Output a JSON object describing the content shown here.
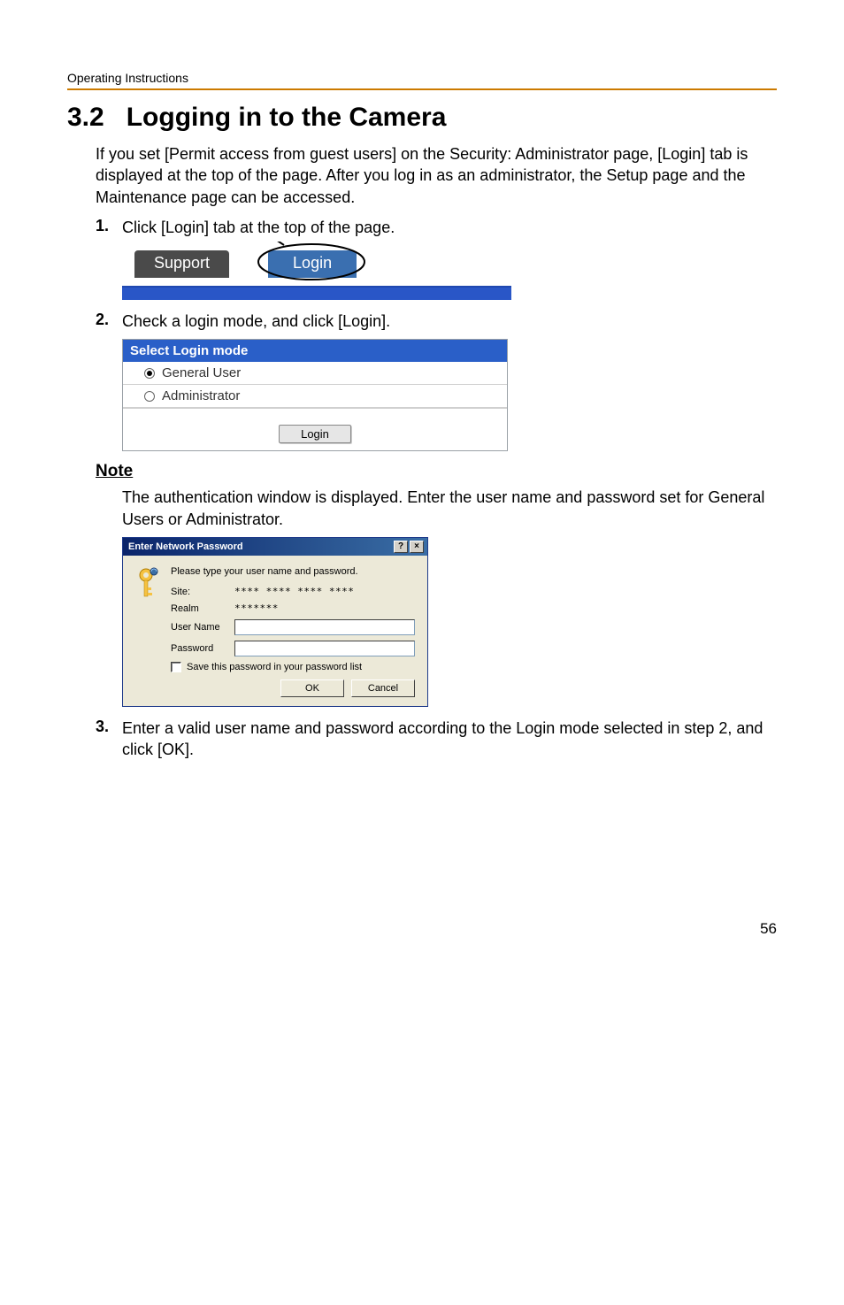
{
  "header": {
    "running": "Operating Instructions"
  },
  "section": {
    "number": "3.2",
    "title": "Logging in to the Camera",
    "intro": "If you set [Permit access from guest users] on the Security: Administrator page, [Login] tab is displayed at the top of the page. After you log in as an administrator, the Setup page and the Maintenance page can be accessed."
  },
  "steps": {
    "s1": {
      "num": "1.",
      "text": "Click [Login] tab at the top of the page."
    },
    "s2": {
      "num": "2.",
      "text": "Check a login mode, and click [Login]."
    },
    "s3": {
      "num": "3.",
      "text": "Enter a valid user name and password according to the Login mode selected in step 2, and click [OK]."
    }
  },
  "fig_tabs": {
    "support": "Support",
    "login": "Login"
  },
  "fig_login_mode": {
    "title": "Select Login mode",
    "opt_general": "General User",
    "opt_admin": "Administrator",
    "login_btn": "Login"
  },
  "note": {
    "heading": "Note",
    "body": "The authentication window is displayed. Enter the user name and password set for General Users or Administrator."
  },
  "fig_pw": {
    "title": "Enter Network Password",
    "help_btn": "?",
    "close_btn": "×",
    "instruction": "Please type your user name and password.",
    "site_label": "Site:",
    "site_value": "**** **** **** ****",
    "realm_label": "Realm",
    "realm_value": "*******",
    "user_label": "User Name",
    "pass_label": "Password",
    "save_label": "Save this password in your password list",
    "ok_btn": "OK",
    "cancel_btn": "Cancel"
  },
  "page_number": "56"
}
